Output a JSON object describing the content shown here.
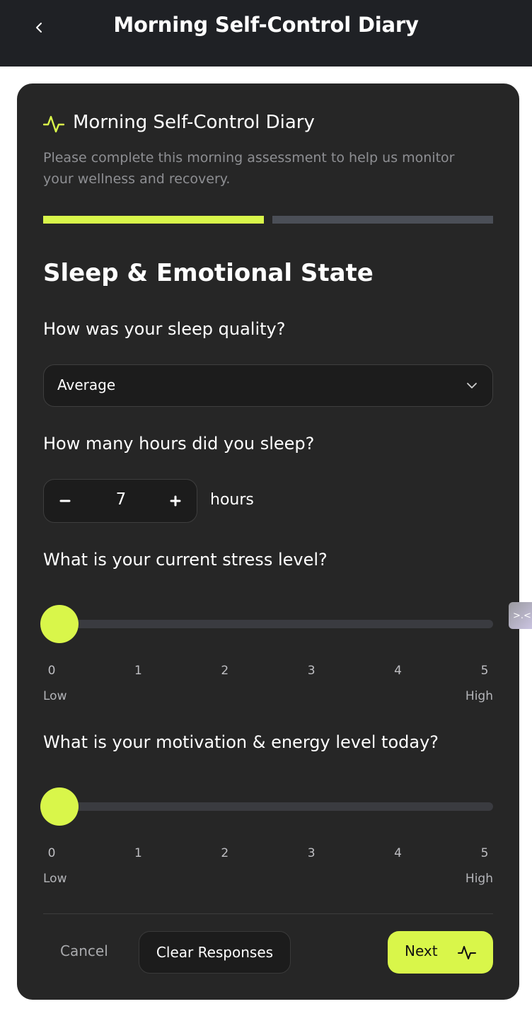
{
  "topbar": {
    "title": "Morning Self-Control Diary",
    "back_icon": "chevron-left-icon"
  },
  "card": {
    "title": "Morning Self-Control Diary",
    "icon": "activity-pulse-icon",
    "subtitle": "Please complete this morning assessment to help us monitor your wellness and recovery.",
    "progress": {
      "current_step": 1,
      "total_steps": 2
    },
    "section_title": "Sleep & Emotional State"
  },
  "questions": {
    "sleep_quality": {
      "label": "How was your sleep quality?",
      "selected": "Average"
    },
    "sleep_hours": {
      "label": "How many hours did you sleep?",
      "value": "7",
      "unit": "hours"
    },
    "stress": {
      "label": "What is your current stress level?",
      "value": 0,
      "ticks": [
        "0",
        "1",
        "2",
        "3",
        "4",
        "5"
      ],
      "low_label": "Low",
      "high_label": "High"
    },
    "motivation": {
      "label": "What is your motivation & energy level today?",
      "value": 0,
      "ticks": [
        "0",
        "1",
        "2",
        "3",
        "4",
        "5"
      ],
      "low_label": "Low",
      "high_label": "High"
    }
  },
  "actions": {
    "cancel": "Cancel",
    "clear": "Clear Responses",
    "next": "Next"
  },
  "side_tab": {
    "label": ">.<"
  },
  "colors": {
    "accent": "#d9f64a",
    "card_bg": "#262626",
    "header_bg": "#1f2125"
  }
}
